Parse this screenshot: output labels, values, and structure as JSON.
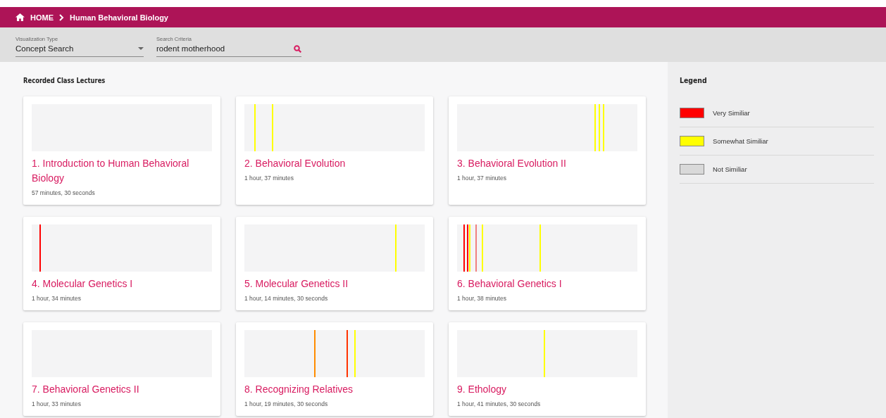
{
  "breadcrumb": {
    "home": "HOME",
    "current": "Human Behavioral Biology"
  },
  "toolbar": {
    "visualization_type": {
      "label": "Visualization Type",
      "value": "Concept Search"
    },
    "search": {
      "label": "Search Criteria",
      "value": "rodent motherhood"
    }
  },
  "section_title": "Recorded Class Lectures",
  "lectures": [
    {
      "title": "1. Introduction to Human Behavioral Biology",
      "duration": "57 minutes, 30 seconds"
    },
    {
      "title": "2. Behavioral Evolution",
      "duration": "1 hour, 37 minutes",
      "marks": [
        {
          "color": "#ffff00",
          "level": 0.055
        },
        {
          "color": "#ffff00",
          "level": 0.152
        }
      ]
    },
    {
      "title": "3. Behavioral Evolution II",
      "duration": "1 hour, 37 minutes",
      "marks": [
        {
          "color": "#ffff00",
          "level": 0.76
        },
        {
          "color": "#ffff00",
          "level": 0.785
        },
        {
          "color": "#ffff00",
          "level": 0.81
        }
      ]
    },
    {
      "title": "4. Molecular Genetics I",
      "duration": "1 hour, 34 minutes",
      "marks": [
        {
          "color": "#ff0000",
          "level": 0.043
        }
      ]
    },
    {
      "title": "5. Molecular Genetics II",
      "duration": "1 hour, 14 minutes, 30 seconds",
      "marks": [
        {
          "color": "#ffff00",
          "level": 0.836
        }
      ]
    },
    {
      "title": "6. Behavioral Genetics I",
      "duration": "1 hour, 38 minutes",
      "marks": [
        {
          "color": "#ff0000",
          "level": 0.035
        },
        {
          "color": "#ff0000",
          "level": 0.055
        },
        {
          "color": "#ffff00",
          "level": 0.067
        },
        {
          "color": "#f08080",
          "level": 0.1
        },
        {
          "color": "#ffff00",
          "level": 0.137
        },
        {
          "color": "#ffff00",
          "level": 0.457
        }
      ]
    },
    {
      "title": "7. Behavioral Genetics II",
      "duration": "1 hour, 33 minutes"
    },
    {
      "title": "8. Recognizing Relatives",
      "duration": "1 hour, 19 minutes, 30 seconds",
      "marks": [
        {
          "color": "#ff8c00",
          "level": 0.387
        },
        {
          "color": "#ff3300",
          "level": 0.566
        },
        {
          "color": "#ffff00",
          "level": 0.609
        }
      ]
    },
    {
      "title": "9. Ethology",
      "duration": "1 hour, 41 minutes, 30 seconds",
      "marks": [
        {
          "color": "#ffff00",
          "level": 0.48
        }
      ]
    }
  ],
  "legend": {
    "title": "Legend",
    "items": [
      {
        "label": "Very Similiar",
        "color": "#ff0000"
      },
      {
        "label": "Somewhat Similiar",
        "color": "#ffff00"
      },
      {
        "label": "Not Similiar",
        "color": "#d9d9d9"
      }
    ]
  }
}
